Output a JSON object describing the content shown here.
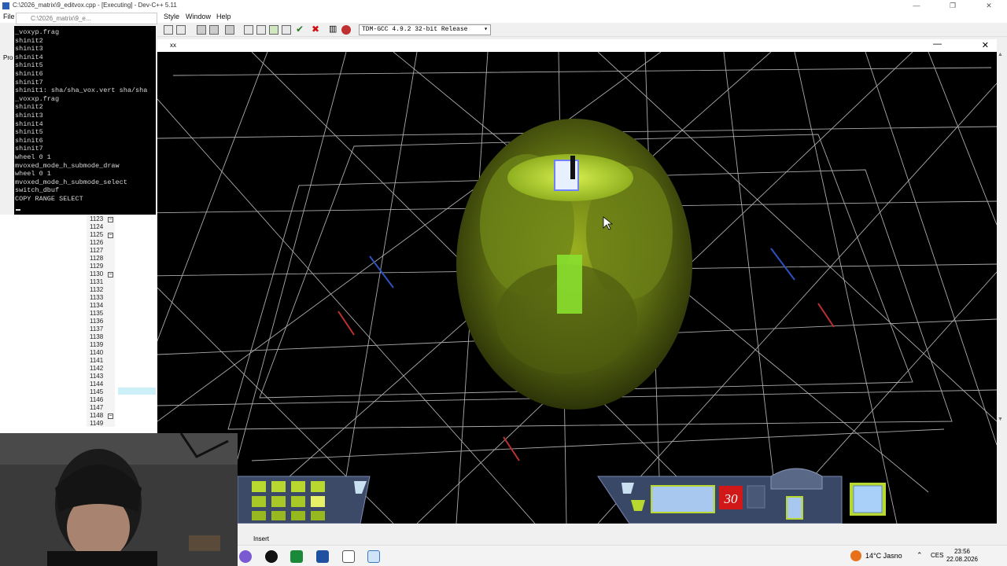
{
  "window_title": "C:\\2026_matrix\\9_editvox.cpp - [Executing] - Dev-C++ 5.11",
  "window_controls": {
    "minimize": "—",
    "maximize": "❐",
    "close": "✕"
  },
  "menu": {
    "file": "File",
    "style": "Style",
    "window": "Window",
    "help": "Help"
  },
  "compiler_select": {
    "value": "TDM-GCC 4.9.2 32-bit Release"
  },
  "console": {
    "title": "C:\\2026_matrix\\9_e...",
    "lines": [
      "_voxyp.frag",
      "shinit2",
      "shinit3",
      "shinit4",
      "shinit5",
      "shinit6",
      "shinit7",
      "shinit1: sha/sha_vox.vert sha/sha",
      "_voxxp.frag",
      "shinit2",
      "shinit3",
      "shinit4",
      "shinit5",
      "shinit6",
      "shinit7",
      "wheel 0 1",
      "mvoxed_mode_h_submode_draw",
      "wheel 0 1",
      "mvoxed_mode_h_submode_select",
      "switch_dbuf",
      "COPY RANGE SELECT"
    ]
  },
  "project_tab_label": "Pro",
  "editor": {
    "line_numbers": [
      "1123",
      "1124",
      "1125",
      "1126",
      "1127",
      "1128",
      "1129",
      "1130",
      "1131",
      "1132",
      "1133",
      "1134",
      "1135",
      "1136",
      "1137",
      "1138",
      "1139",
      "1140",
      "1141",
      "1142",
      "1143",
      "1144",
      "1145",
      "1146",
      "1147",
      "1148",
      "1149"
    ]
  },
  "viewport": {
    "title": "xx",
    "close_label": "✕",
    "min_label": "—",
    "hud_counter": "30",
    "colors": {
      "voxel_dark": "#5a6a10",
      "voxel_light": "#b8d830",
      "grid": "#e0e0e0",
      "hud_panel": "#3a4a6a"
    }
  },
  "statusbar": {
    "mode": "Insert"
  },
  "taskbar": {
    "weather": "14°C  Jasno",
    "language": "CES",
    "time": "23:56",
    "date": "22.08.2026"
  }
}
